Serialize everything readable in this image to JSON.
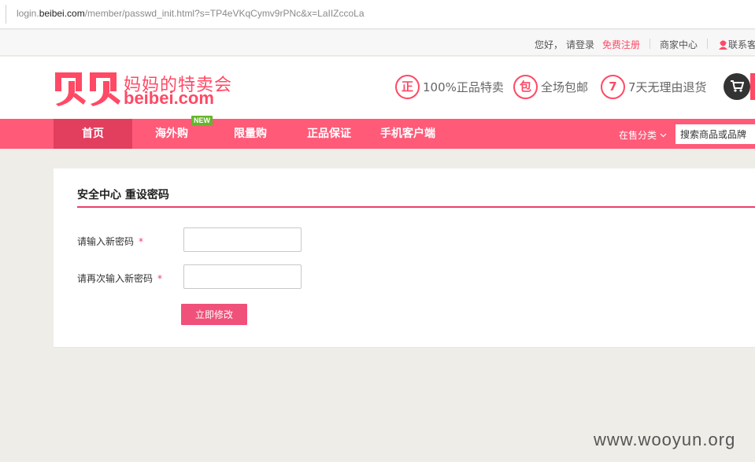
{
  "browser": {
    "url_host_prefix": "login.",
    "url_host": "beibei.com",
    "url_path": "/member/passwd_init.html?s=TP4eVKqCymv9rPNc&x=LaIIZccoLa"
  },
  "top_links": {
    "greeting": "您好，",
    "login": "请登录",
    "register": "免费注册",
    "merchant": "商家中心",
    "contact": "联系客"
  },
  "logo": {
    "tagline": "妈妈的特卖会",
    "domain": "beibei.com"
  },
  "promises": [
    {
      "badge": "正",
      "text": "100%正品特卖"
    },
    {
      "badge": "包",
      "text": "全场包邮"
    },
    {
      "badge": "7",
      "text": "7天无理由退货"
    }
  ],
  "nav": {
    "items": [
      "首页",
      "海外购",
      "限量购",
      "正品保证",
      "手机客户端"
    ],
    "new_badge": "NEW",
    "category_selector": "在售分类",
    "search_placeholder": "搜索商品或品牌"
  },
  "form": {
    "title": "安全中心 重设密码",
    "new_password_label": "请输入新密码",
    "confirm_password_label": "请再次输入新密码",
    "required_mark": "*",
    "submit_label": "立即修改"
  },
  "watermark": "www.wooyun.org",
  "colors": {
    "brand": "#ff4965",
    "nav": "#ff5a78",
    "nav_active": "#e23e5e",
    "button": "#f0517a"
  }
}
